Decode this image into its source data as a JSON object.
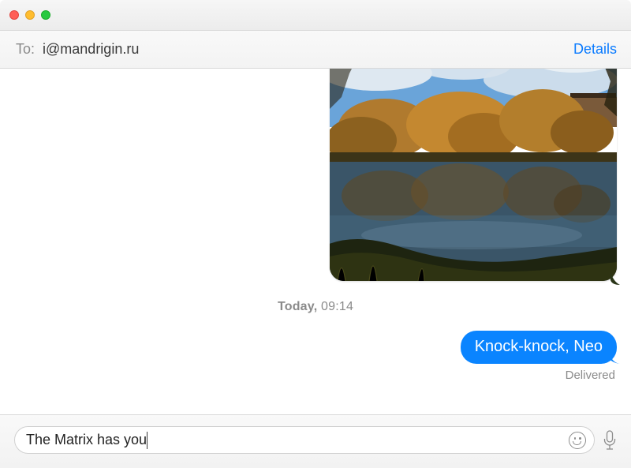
{
  "header": {
    "to_label": "To:",
    "to_value": "i@mandrigin.ru",
    "details_label": "Details"
  },
  "thread": {
    "timestamp_day": "Today,",
    "timestamp_time": "09:14",
    "sent_message": "Knock-knock, Neo",
    "delivered_label": "Delivered",
    "image_alt": "photo-attachment"
  },
  "composer": {
    "input_value": "The Matrix has you",
    "emoji_icon": "smiley-face-icon",
    "mic_icon": "microphone-icon"
  }
}
